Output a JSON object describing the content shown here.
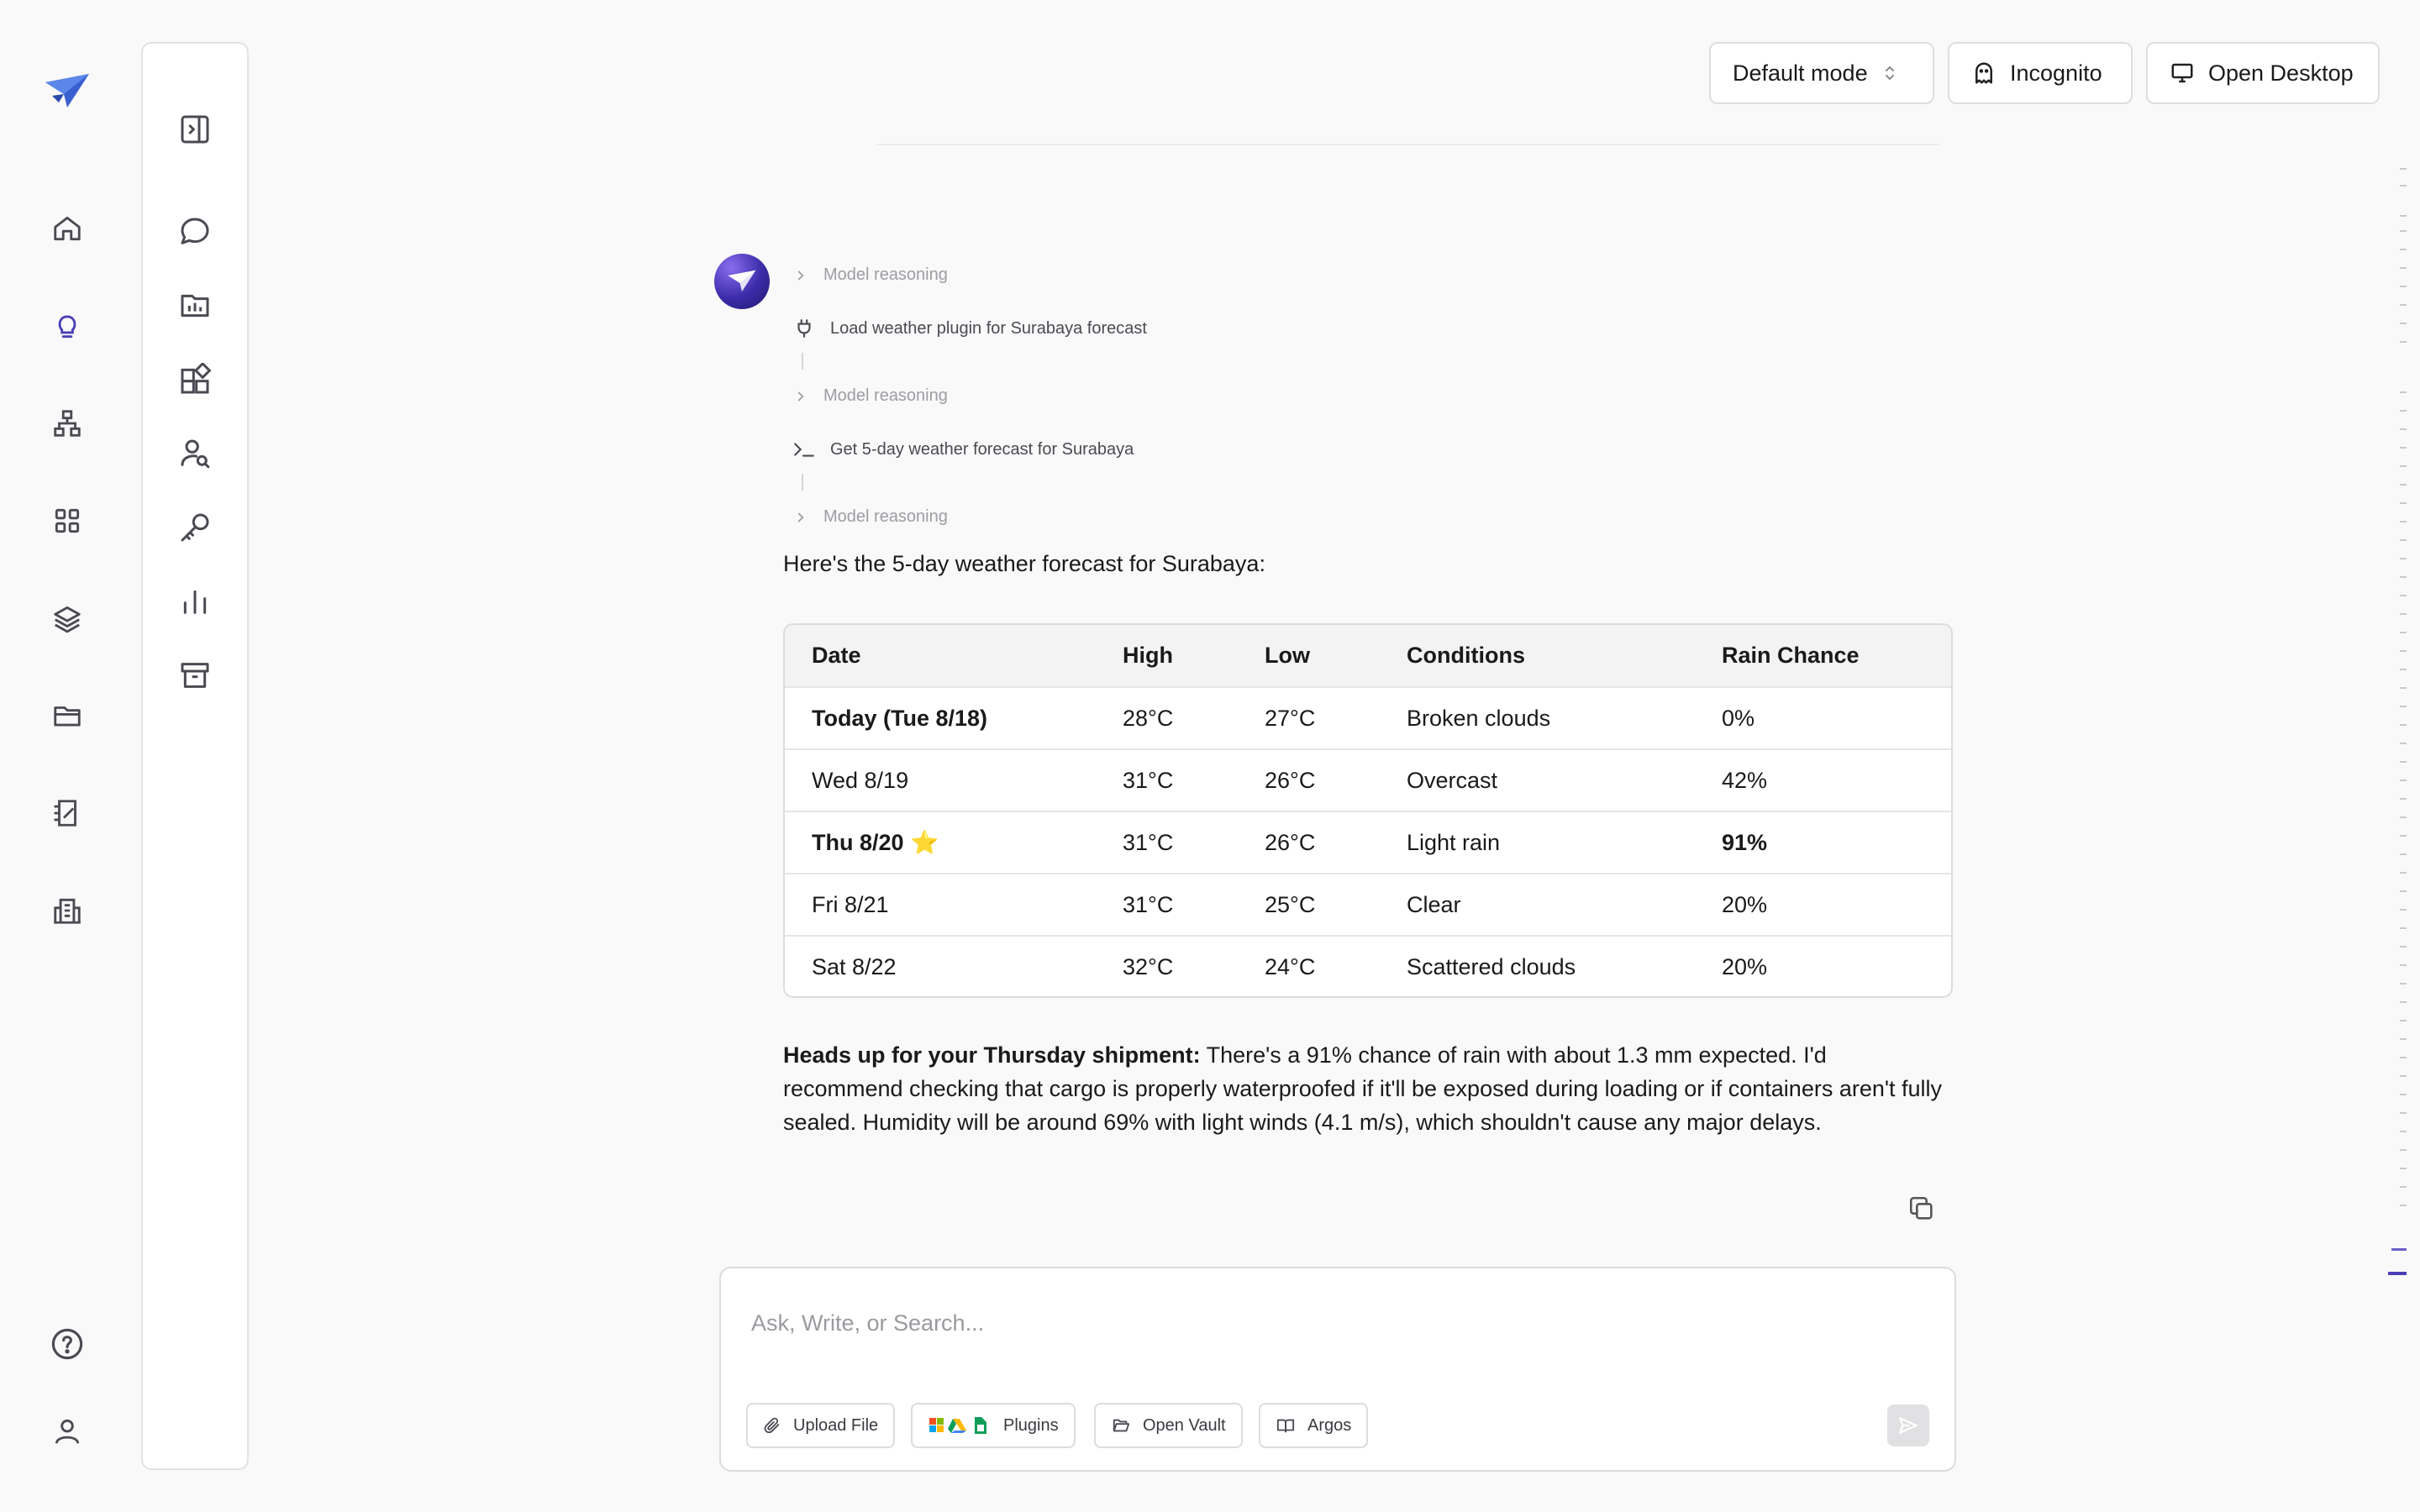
{
  "top_bar": {
    "mode_label": "Default mode",
    "incognito_label": "Incognito",
    "open_desktop_label": "Open Desktop"
  },
  "rail": {
    "items": [
      "home-icon",
      "lightbulb-icon",
      "org-chart-icon",
      "apps-grid-icon",
      "layers-icon",
      "folder-icon",
      "notebook-icon",
      "building-icon"
    ],
    "bottom": [
      "help-icon",
      "user-icon"
    ],
    "active": "lightbulb-icon"
  },
  "panel": {
    "items": [
      "sidebar-toggle-icon",
      "chat-bubble-icon",
      "folder-chart-icon",
      "widgets-icon",
      "user-search-icon",
      "key-icon",
      "bar-chart-icon",
      "archive-icon"
    ]
  },
  "steps": [
    {
      "type": "reasoning",
      "label": "Model reasoning"
    },
    {
      "type": "tool",
      "icon": "plug-icon",
      "label": "Load weather plugin for Surabaya forecast"
    },
    {
      "type": "reasoning",
      "label": "Model reasoning"
    },
    {
      "type": "tool",
      "icon": "terminal-icon",
      "label": "Get 5-day weather forecast for Surabaya"
    },
    {
      "type": "reasoning",
      "label": "Model reasoning"
    }
  ],
  "message": {
    "intro": "Here's the 5-day weather forecast for Surabaya:",
    "table": {
      "headers": [
        "Date",
        "High",
        "Low",
        "Conditions",
        "Rain Chance"
      ],
      "rows": [
        [
          "Today (Tue 8/18)",
          "28°C",
          "27°C",
          "Broken clouds",
          "0%"
        ],
        [
          "Wed 8/19",
          "31°C",
          "26°C",
          "Overcast",
          "42%"
        ],
        [
          "Thu 8/20",
          "31°C",
          "26°C",
          "Light rain",
          "91%"
        ],
        [
          "Fri 8/21",
          "31°C",
          "25°C",
          "Clear",
          "20%"
        ],
        [
          "Sat 8/22",
          "32°C",
          "24°C",
          "Scattered clouds",
          "20%"
        ]
      ],
      "star": "⭐"
    },
    "heads_up_bold": "Heads up for your Thursday shipment:",
    "heads_up_text": " There's a 91% chance of rain with about 1.3 mm expected. I'd recommend checking that cargo is properly waterproofed if it'll be exposed during loading or if containers aren't fully sealed. Humidity will be around 69% with light winds (4.1 m/s), which shouldn't cause any major delays."
  },
  "composer": {
    "placeholder": "Ask, Write, or Search...",
    "upload_label": "Upload File",
    "plugins_label": "Plugins",
    "vault_label": "Open Vault",
    "argos_label": "Argos"
  },
  "colors": {
    "accent": "#4b3fb5",
    "background": "#f9f9f9",
    "border": "#dcdce0"
  }
}
